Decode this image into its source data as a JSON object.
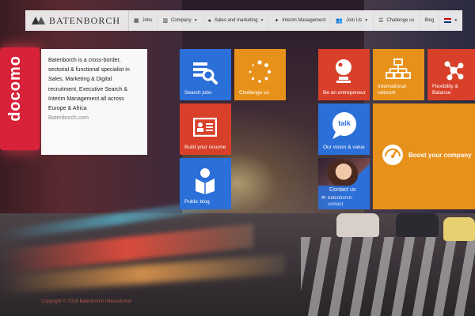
{
  "brand": {
    "name": "BATENBORCH"
  },
  "nav": {
    "items": [
      {
        "icon": "jobs-icon",
        "label": "Jobs",
        "dropdown": false
      },
      {
        "icon": "company-icon",
        "label": "Company",
        "dropdown": true
      },
      {
        "icon": "sales-icon",
        "label": "Sales and marketing",
        "dropdown": true
      },
      {
        "icon": "interim-icon",
        "label": "Interim Management",
        "dropdown": false
      },
      {
        "icon": "join-icon",
        "label": "Join Us",
        "dropdown": true
      },
      {
        "icon": "challenge-icon",
        "label": "Challenge us",
        "dropdown": false
      },
      {
        "icon": "",
        "label": "Blog",
        "dropdown": false
      }
    ],
    "language_flag": "uk-flag-icon"
  },
  "intro": {
    "text": "Batenborch is a cross-border, sectorial & functional specialist in Sales, Marketing & Digital recruitment, Executive Search & Interim Management all across Europe & Africa",
    "link": "Batenborch.com"
  },
  "tiles": {
    "search_jobs": {
      "label": "Search jobs",
      "icon": "search-jobs-icon",
      "color": "#2b6fd8"
    },
    "challenge_us": {
      "label": "Challenge us",
      "icon": "spinner-icon",
      "color": "#e8911a"
    },
    "build_resume": {
      "label": "Build your resume",
      "icon": "resume-icon",
      "color": "#d9402a"
    },
    "public_blog": {
      "label": "Public blog",
      "icon": "blog-icon",
      "color": "#2b6fd8"
    },
    "entrepreneur": {
      "label": "Be an entrepeneur",
      "icon": "crystal-ball-icon",
      "color": "#d9402a"
    },
    "international": {
      "label": "International network",
      "icon": "network-icon",
      "color": "#e8911a"
    },
    "flexibility": {
      "label": "Flexibility & Balance",
      "icon": "molecule-icon",
      "color": "#d9402a"
    },
    "vision": {
      "label": "Our vision & value",
      "icon": "talk-bubble-icon",
      "bubble_text": "talk",
      "color": "#2b6fd8"
    },
    "contact": {
      "label": "Contact us",
      "sub_label": "batenborch-contact",
      "icon": "contact-icon"
    },
    "boost": {
      "label": "Boost your company",
      "icon": "gauge-icon",
      "color": "#e8911a"
    }
  },
  "footer": {
    "copyright": "Copyright © 2016 Batenborch International"
  }
}
